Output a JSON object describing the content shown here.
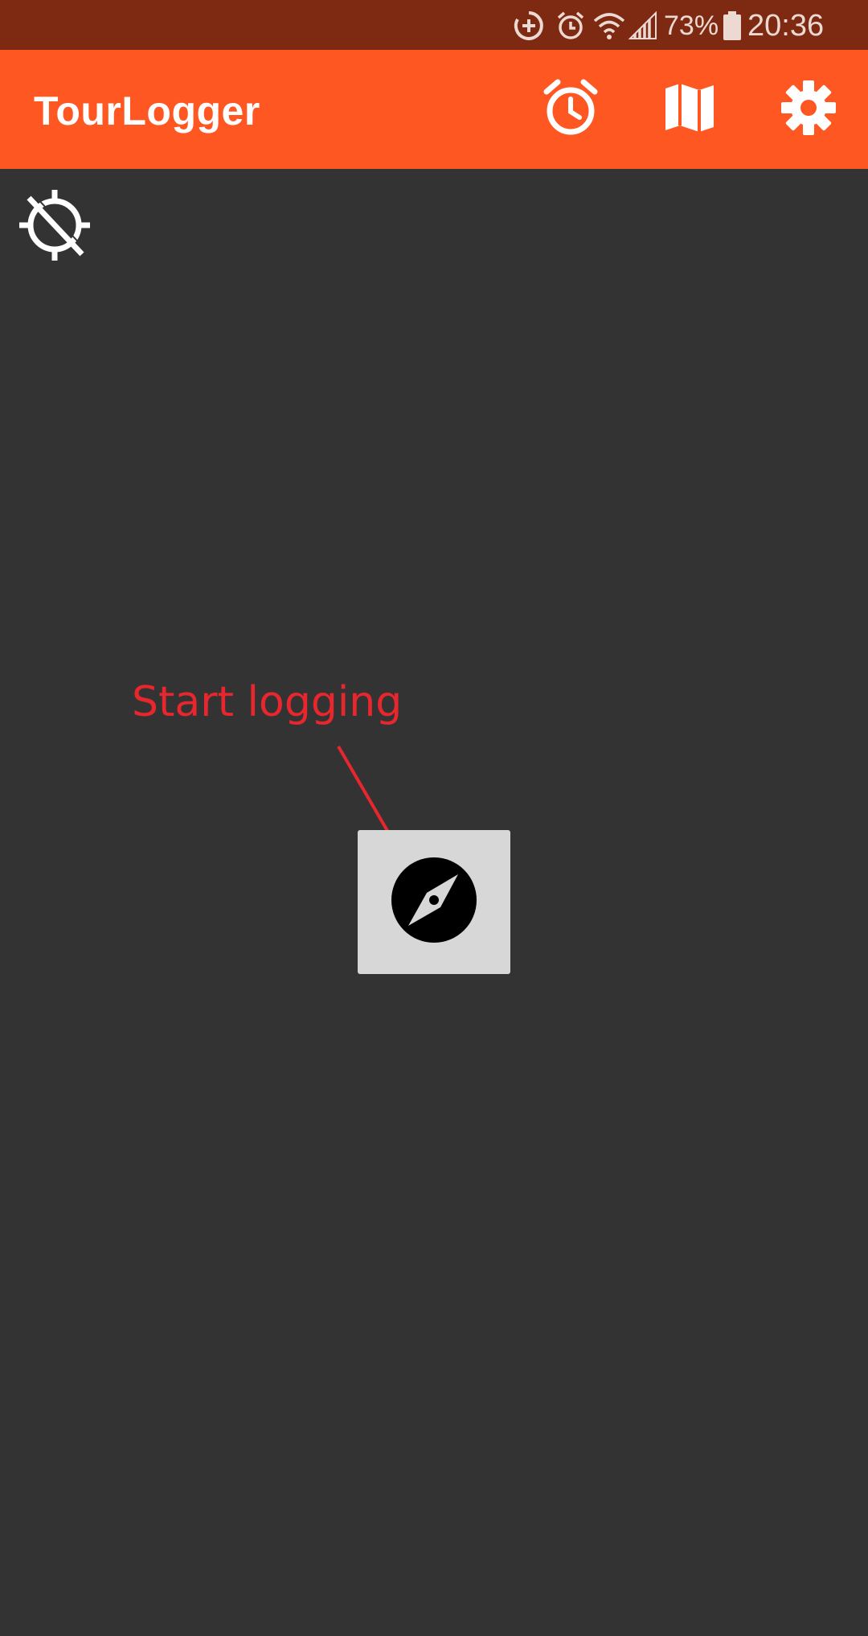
{
  "status_bar": {
    "icons": [
      "data-saver-icon",
      "alarm-icon",
      "wifi-icon",
      "signal-icon",
      "battery-icon"
    ],
    "battery_percent": "73%",
    "time": "20:36"
  },
  "app_bar": {
    "title": "TourLogger",
    "background_color": "#ff5722",
    "actions": [
      {
        "name": "alarm-clock-icon",
        "label": "Alarm"
      },
      {
        "name": "map-icon",
        "label": "Map"
      },
      {
        "name": "settings-gear-icon",
        "label": "Settings"
      }
    ]
  },
  "main": {
    "gps_status_icon": "gps-off-icon",
    "start_button": {
      "icon": "compass-icon"
    },
    "annotation": {
      "text": "Start logging",
      "color": "#e8262d"
    }
  }
}
